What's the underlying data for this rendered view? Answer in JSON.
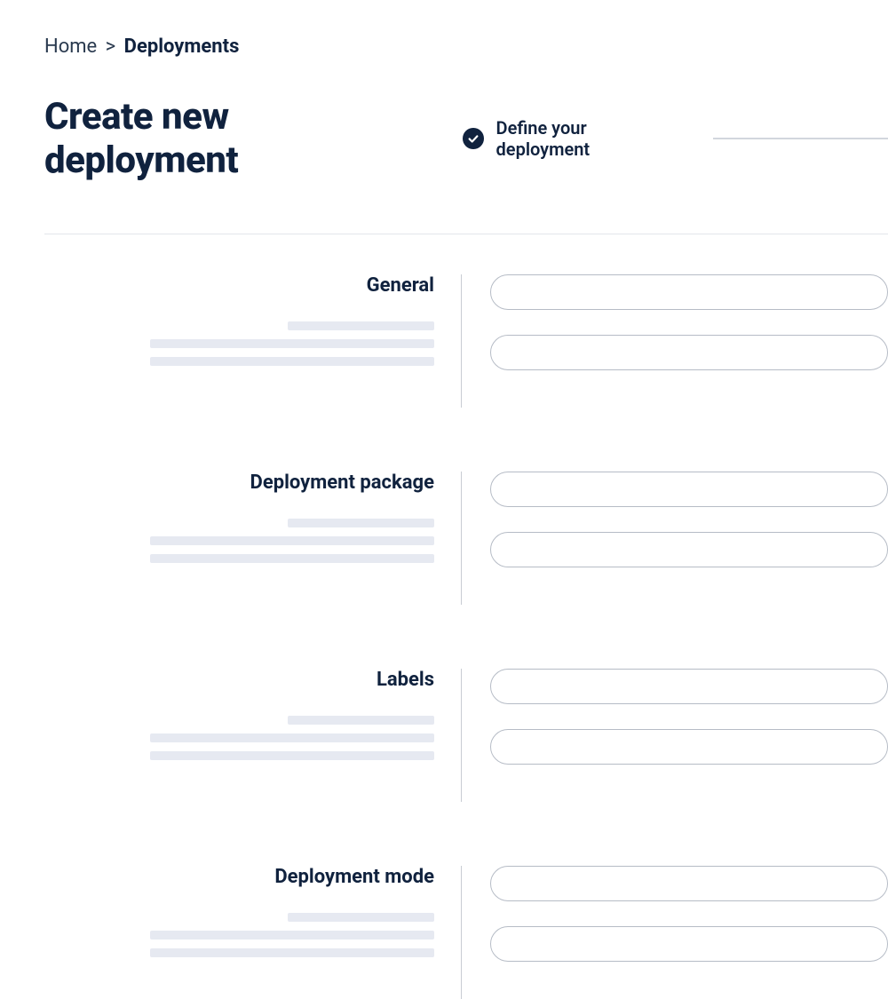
{
  "breadcrumb": {
    "home": "Home",
    "separator": ">",
    "current": "Deployments"
  },
  "header": {
    "title": "Create new deployment",
    "step_label": "Define your deployment"
  },
  "sections": {
    "general": {
      "title": "General"
    },
    "package": {
      "title": "Deployment package"
    },
    "labels": {
      "title": "Labels"
    },
    "mode": {
      "title": "Deployment mode"
    }
  }
}
